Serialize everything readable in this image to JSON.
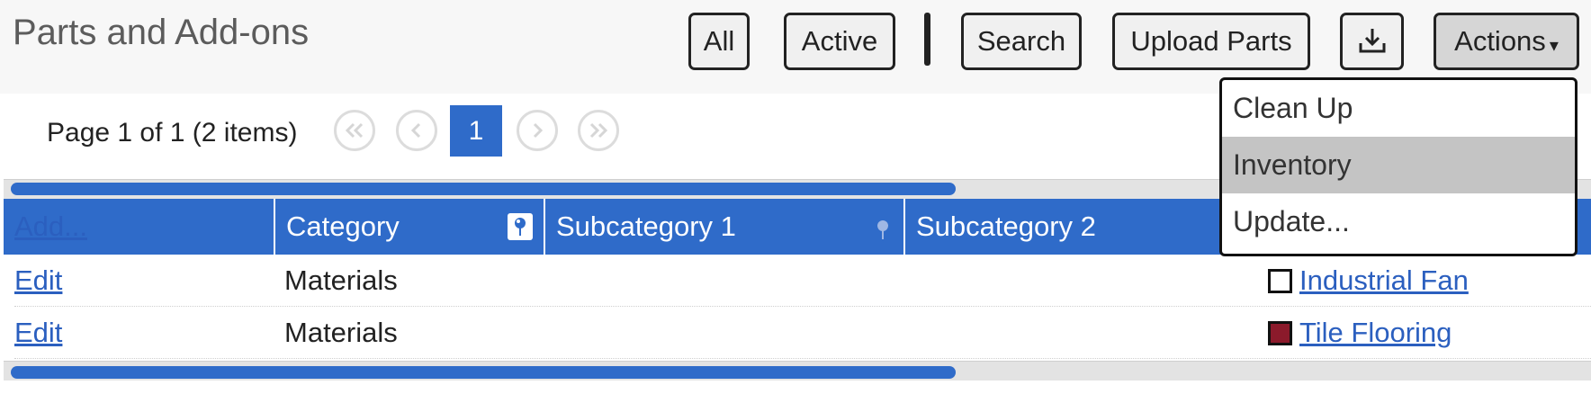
{
  "page": {
    "title": "Parts and Add-ons"
  },
  "toolbar": {
    "all_label": "All",
    "active_label": "Active",
    "search_label": "Search",
    "upload_label": "Upload Parts",
    "download_icon": "download-tray-icon",
    "actions_label": "Actions",
    "actions_caret": "▾"
  },
  "actions_menu": {
    "items": [
      {
        "label": "Clean Up",
        "highlighted": false
      },
      {
        "label": "Inventory",
        "highlighted": true
      },
      {
        "label": "Update...",
        "highlighted": false
      }
    ]
  },
  "pager": {
    "summary": "Page 1 of 1 (2 items)",
    "current_page": "1",
    "icons": [
      "first-page-icon",
      "previous-page-icon",
      "next-page-icon",
      "last-page-icon"
    ]
  },
  "grid": {
    "columns": [
      {
        "label": "Add...",
        "is_link": true
      },
      {
        "label": "Category",
        "filter_active": true
      },
      {
        "label": "Subcategory 1",
        "filter_active": false
      },
      {
        "label": "Subcategory 2"
      }
    ],
    "rows": [
      {
        "action": "Edit",
        "category": "Materials",
        "swatch_color": "#ffffff",
        "name": "Industrial Fan"
      },
      {
        "action": "Edit",
        "category": "Materials",
        "swatch_color": "#8b1a2b",
        "name": "Tile Flooring"
      }
    ]
  },
  "colors": {
    "accent": "#2f6bc9",
    "scroll_track": "#e3e3e3"
  }
}
